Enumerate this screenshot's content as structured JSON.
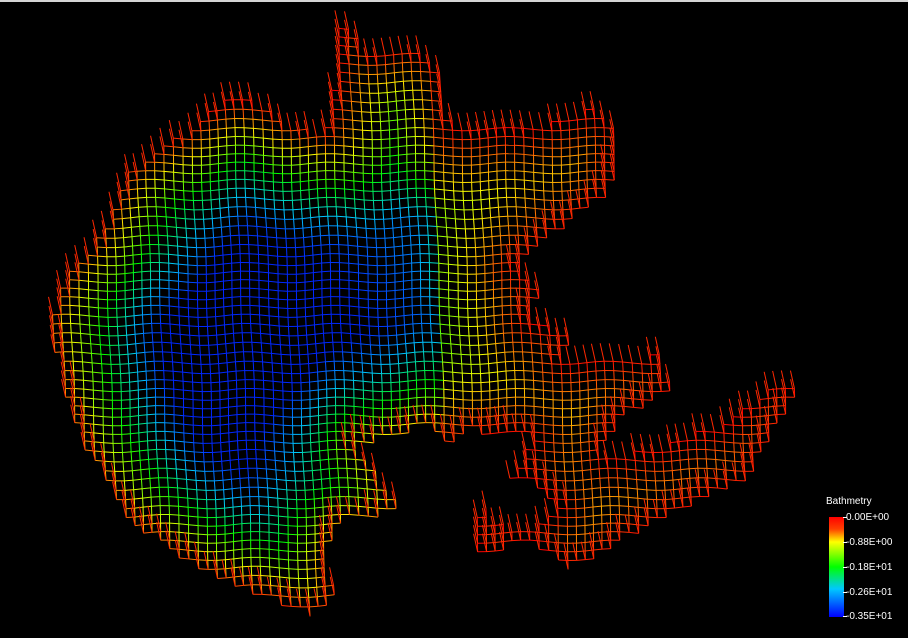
{
  "legend": {
    "title": "Bathmetry",
    "labels": [
      "0.00E+00",
      "-0.88E+00",
      "-0.18E+01",
      "-0.26E+01",
      "-0.35E+01"
    ],
    "colors": [
      "#ff0000",
      "#ffff00",
      "#00ff00",
      "#00c8ff",
      "#0000ff"
    ]
  },
  "colors": {
    "background": "#000000",
    "frame_edge": "#d4d4d4"
  }
}
